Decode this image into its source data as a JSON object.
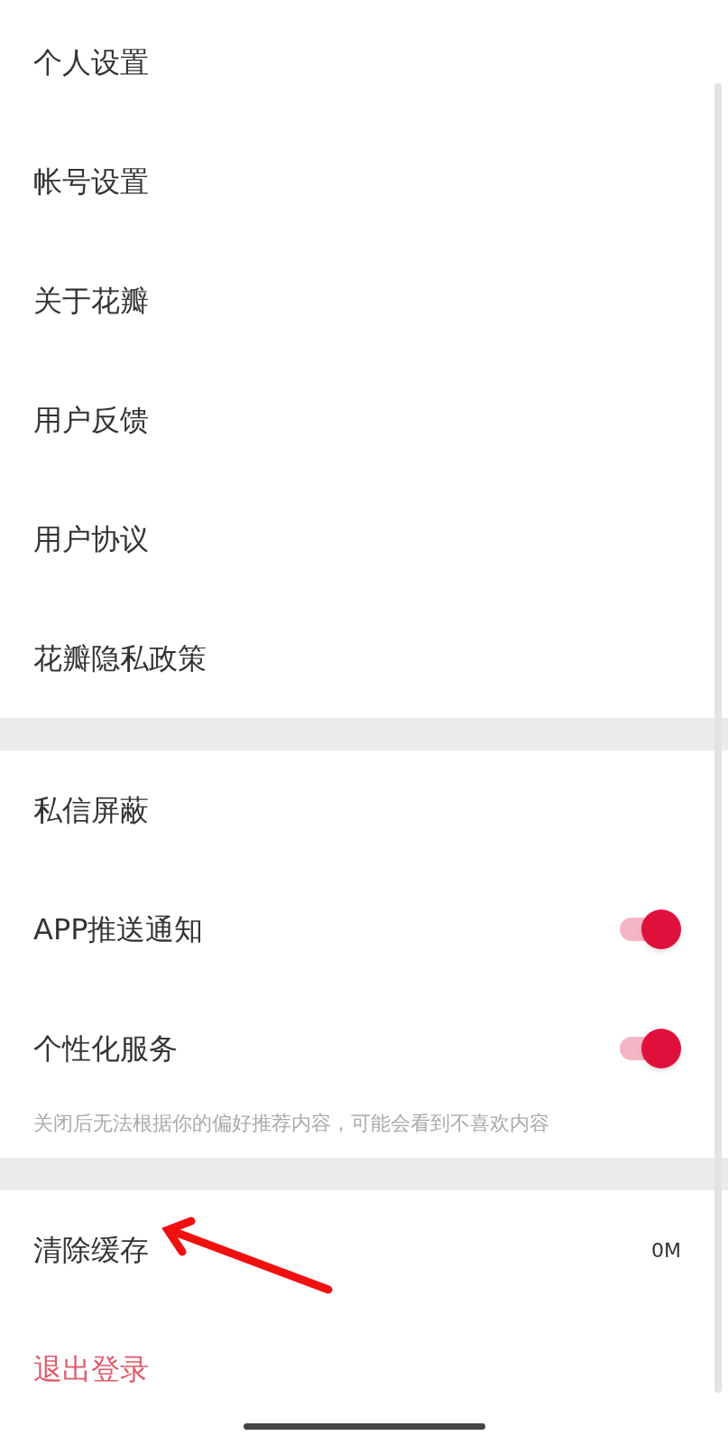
{
  "sections": [
    {
      "items": [
        {
          "label": "个人设置"
        },
        {
          "label": "帐号设置"
        },
        {
          "label": "关于花瓣"
        },
        {
          "label": "用户反馈"
        },
        {
          "label": "用户协议"
        },
        {
          "label": "花瓣隐私政策"
        }
      ]
    },
    {
      "items": [
        {
          "label": "私信屏蔽",
          "kind": "link"
        },
        {
          "label": "APP推送通知",
          "kind": "toggle",
          "on": true
        },
        {
          "label": "个性化服务",
          "kind": "toggle",
          "on": true,
          "hint": "关闭后无法根据你的偏好推荐内容，可能会看到不喜欢内容"
        }
      ]
    },
    {
      "items": [
        {
          "label": "清除缓存",
          "kind": "value",
          "value": "0M"
        },
        {
          "label": "退出登录",
          "kind": "danger"
        }
      ]
    }
  ]
}
